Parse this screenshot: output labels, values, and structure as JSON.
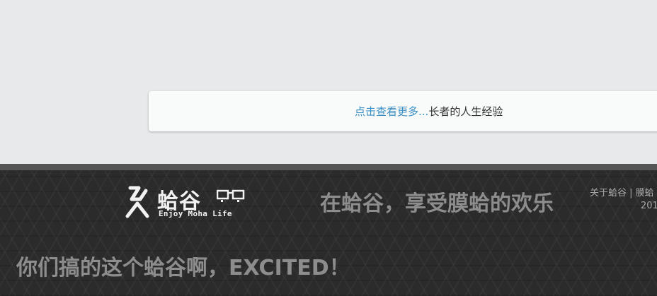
{
  "more": {
    "link_label": "点击查看更多...",
    "suffix": "长者的人生经验"
  },
  "footer": {
    "logo": {
      "title": "蛤谷",
      "subtitle": "Enjoy Moha Life",
      "mark_icon": "ha-mark-icon",
      "glasses_icon": "glasses-icon"
    },
    "slogan": "在蛤谷，享受膜蛤的欢乐",
    "links": {
      "about": "关于蛤谷",
      "separator": " | ",
      "moha": "膜蛤"
    },
    "year": "201",
    "excited": "你们搞的这个蛤谷啊，EXCITED！"
  },
  "colors": {
    "page_bg": "#e8e9eb",
    "card_bg": "#f9fafa",
    "link": "#3a8fc4",
    "footer_bg": "#2b2b2b",
    "footer_topbar": "#555555",
    "slogan": "#8d8d8d"
  }
}
